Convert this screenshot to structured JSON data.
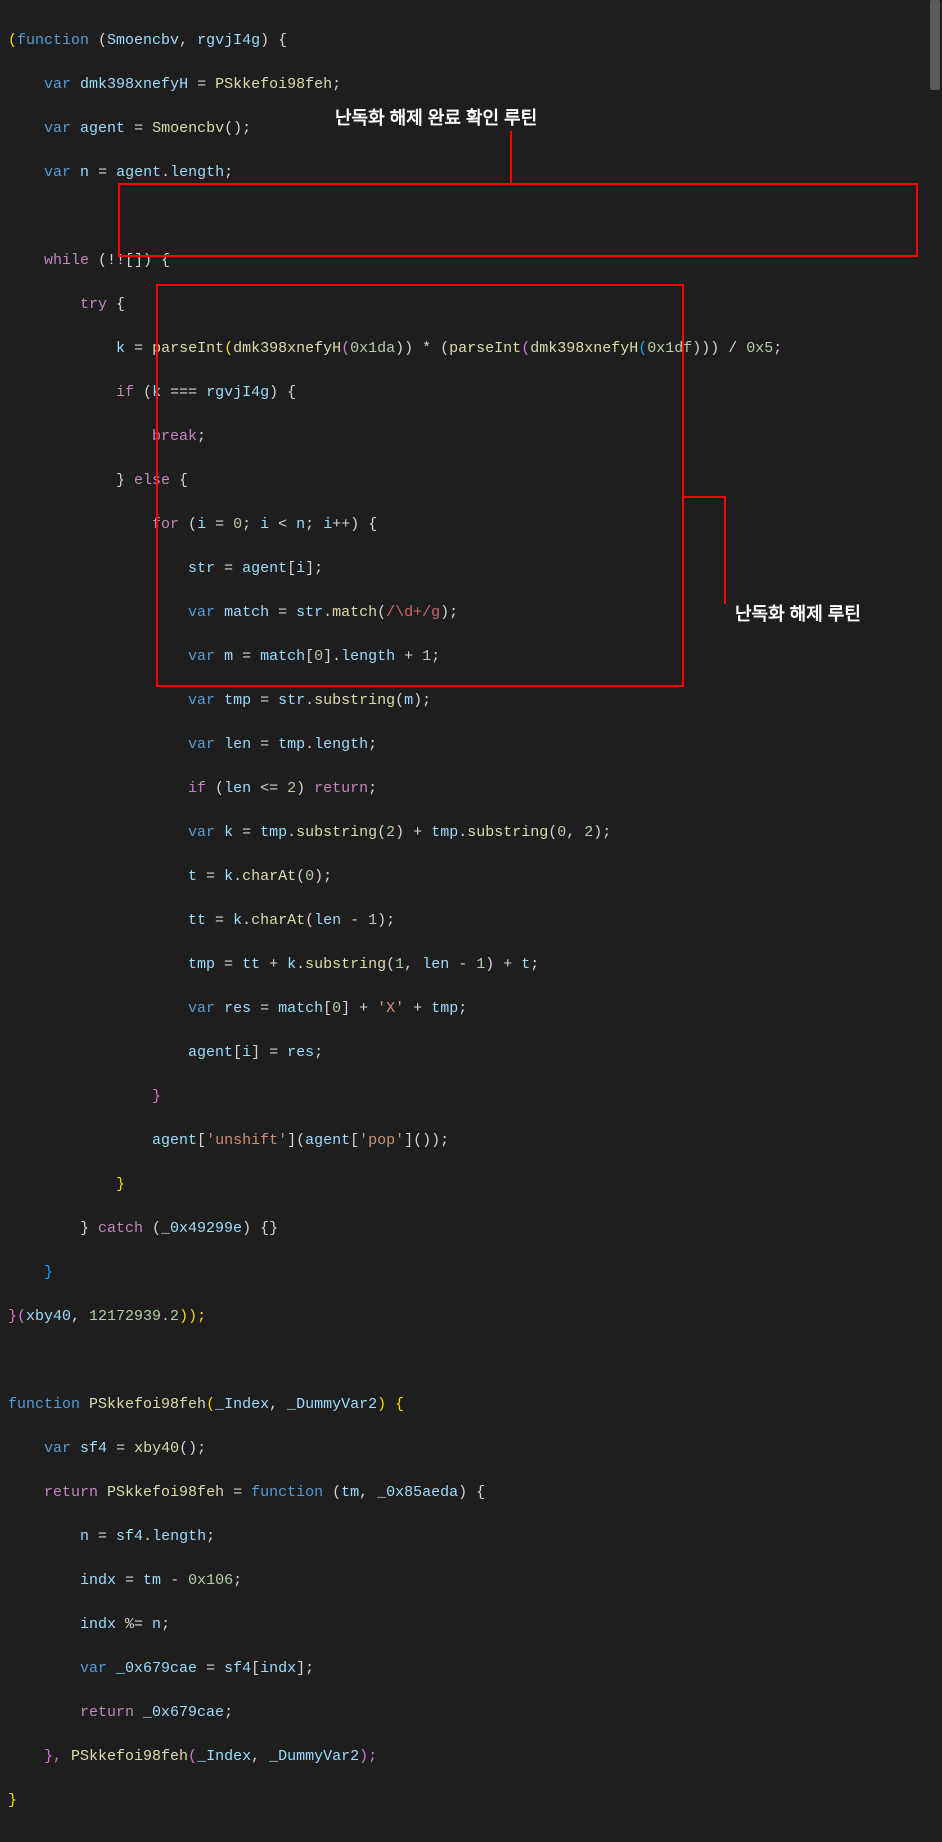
{
  "annotations": {
    "top": "난독화 해제 완료 확인 루틴",
    "right": "난독화 해제 루틴"
  },
  "code": {
    "l1": {
      "a": "(",
      "b": "function",
      "c": " (",
      "d": "Smoencbv",
      "e": ", ",
      "f": "rgvjI4g",
      "g": ") {"
    },
    "l2": {
      "a": "    ",
      "b": "var",
      "c": " ",
      "d": "dmk398xnefyH",
      "e": " = ",
      "f": "PSkkefoi98feh",
      "g": ";"
    },
    "l3": {
      "a": "    ",
      "b": "var",
      "c": " ",
      "d": "agent",
      "e": " = ",
      "f": "Smoencbv",
      "g": "();"
    },
    "l4": {
      "a": "    ",
      "b": "var",
      "c": " ",
      "d": "n",
      "e": " = ",
      "f": "agent",
      "g": ".",
      "h": "length",
      "i": ";"
    },
    "l6": {
      "a": "    ",
      "b": "while",
      "c": " (!![]) {"
    },
    "l7": {
      "a": "        ",
      "b": "try",
      "c": " {"
    },
    "l8": {
      "a": "            ",
      "b": "k",
      "c": " = ",
      "d": "parseInt",
      "e": "(",
      "f": "dmk398xnefyH",
      "g": "(",
      "h": "0x1da",
      "i": ")) * (",
      "j": "parseInt",
      "k": "(",
      "l": "dmk398xnefyH",
      "m": "(",
      "n": "0x1df",
      "o": "))) / ",
      "p": "0x5",
      "q": ";"
    },
    "l9": {
      "a": "            ",
      "b": "if",
      "c": " (",
      "d": "k",
      "e": " === ",
      "f": "rgvjI4g",
      "g": ") {"
    },
    "l10": {
      "a": "                ",
      "b": "break",
      "c": ";"
    },
    "l11": {
      "a": "            } ",
      "b": "else",
      "c": " {"
    },
    "l12": {
      "a": "                ",
      "b": "for",
      "c": " (",
      "d": "i",
      "e": " = ",
      "f": "0",
      "g": "; ",
      "h": "i",
      "i": " < ",
      "j": "n",
      "k": "; ",
      "l": "i",
      "m": "++) {"
    },
    "l13": {
      "a": "                    ",
      "b": "str",
      "c": " = ",
      "d": "agent",
      "e": "[",
      "f": "i",
      "g": "];"
    },
    "l14": {
      "a": "                    ",
      "b": "var",
      "c": " ",
      "d": "match",
      "e": " = ",
      "f": "str",
      "g": ".",
      "h": "match",
      "i": "(",
      "j": "/\\d+/g",
      "k": ");"
    },
    "l15": {
      "a": "                    ",
      "b": "var",
      "c": " ",
      "d": "m",
      "e": " = ",
      "f": "match",
      "g": "[",
      "h": "0",
      "i": "].",
      "j": "length",
      "k": " + ",
      "l": "1",
      "m": ";"
    },
    "l16": {
      "a": "                    ",
      "b": "var",
      "c": " ",
      "d": "tmp",
      "e": " = ",
      "f": "str",
      "g": ".",
      "h": "substring",
      "i": "(",
      "j": "m",
      "k": ");"
    },
    "l17": {
      "a": "                    ",
      "b": "var",
      "c": " ",
      "d": "len",
      "e": " = ",
      "f": "tmp",
      "g": ".",
      "h": "length",
      "i": ";"
    },
    "l18": {
      "a": "                    ",
      "b": "if",
      "c": " (",
      "d": "len",
      "e": " <= ",
      "f": "2",
      "g": ") ",
      "h": "return",
      "i": ";"
    },
    "l19": {
      "a": "                    ",
      "b": "var",
      "c": " ",
      "d": "k",
      "e": " = ",
      "f": "tmp",
      "g": ".",
      "h": "substring",
      "i": "(",
      "j": "2",
      "k": ") + ",
      "l": "tmp",
      "m": ".",
      "n": "substring",
      "o": "(",
      "p": "0",
      "q": ", ",
      "r": "2",
      "s": ");"
    },
    "l20": {
      "a": "                    ",
      "b": "t",
      "c": " = ",
      "d": "k",
      "e": ".",
      "f": "charAt",
      "g": "(",
      "h": "0",
      "i": ");"
    },
    "l21": {
      "a": "                    ",
      "b": "tt",
      "c": " = ",
      "d": "k",
      "e": ".",
      "f": "charAt",
      "g": "(",
      "h": "len",
      "i": " - ",
      "j": "1",
      "k": ");"
    },
    "l22": {
      "a": "                    ",
      "b": "tmp",
      "c": " = ",
      "d": "tt",
      "e": " + ",
      "f": "k",
      "g": ".",
      "h": "substring",
      "i": "(",
      "j": "1",
      "k": ", ",
      "l": "len",
      "m": " - ",
      "n": "1",
      "o": ") + ",
      "p": "t",
      "q": ";"
    },
    "l23": {
      "a": "                    ",
      "b": "var",
      "c": " ",
      "d": "res",
      "e": " = ",
      "f": "match",
      "g": "[",
      "h": "0",
      "i": "] + ",
      "j": "'X'",
      "k": " + ",
      "l": "tmp",
      "m": ";"
    },
    "l24": {
      "a": "                    ",
      "b": "agent",
      "c": "[",
      "d": "i",
      "e": "] = ",
      "f": "res",
      "g": ";"
    },
    "l25": {
      "a": "                }"
    },
    "l26": {
      "a": "                ",
      "b": "agent",
      "c": "[",
      "d": "'unshift'",
      "e": "](",
      "f": "agent",
      "g": "[",
      "h": "'pop'",
      "i": "]());"
    },
    "l27": {
      "a": "            }"
    },
    "l28": {
      "a": "        } ",
      "b": "catch",
      "c": " (",
      "d": "_0x49299e",
      "e": ") {}"
    },
    "l29": {
      "a": "    }"
    },
    "l30": {
      "a": "}(",
      "b": "xby40",
      "c": ", ",
      "d": "12172939.2",
      "e": "));"
    },
    "l32": {
      "a": "function",
      "b": " ",
      "c": "PSkkefoi98feh",
      "d": "(",
      "e": "_Index",
      "f": ", ",
      "g": "_DummyVar2",
      "h": ") {"
    },
    "l33": {
      "a": "    ",
      "b": "var",
      "c": " ",
      "d": "sf4",
      "e": " = ",
      "f": "xby40",
      "g": "();"
    },
    "l34": {
      "a": "    ",
      "b": "return",
      "c": " ",
      "d": "PSkkefoi98feh",
      "e": " = ",
      "f": "function",
      "g": " (",
      "h": "tm",
      "i": ", ",
      "j": "_0x85aeda",
      "k": ") {"
    },
    "l35": {
      "a": "        ",
      "b": "n",
      "c": " = ",
      "d": "sf4",
      "e": ".",
      "f": "length",
      "g": ";"
    },
    "l36": {
      "a": "        ",
      "b": "indx",
      "c": " = ",
      "d": "tm",
      "e": " - ",
      "f": "0x106",
      "g": ";"
    },
    "l37": {
      "a": "        ",
      "b": "indx",
      "c": " %= ",
      "d": "n",
      "e": ";"
    },
    "l38": {
      "a": "        ",
      "b": "var",
      "c": " ",
      "d": "_0x679cae",
      "e": " = ",
      "f": "sf4",
      "g": "[",
      "h": "indx",
      "i": "];"
    },
    "l39": {
      "a": "        ",
      "b": "return",
      "c": " ",
      "d": "_0x679cae",
      "e": ";"
    },
    "l40": {
      "a": "    }, ",
      "b": "PSkkefoi98feh",
      "c": "(",
      "d": "_Index",
      "e": ", ",
      "f": "_DummyVar2",
      "g": ");"
    },
    "l41": {
      "a": "}"
    }
  }
}
